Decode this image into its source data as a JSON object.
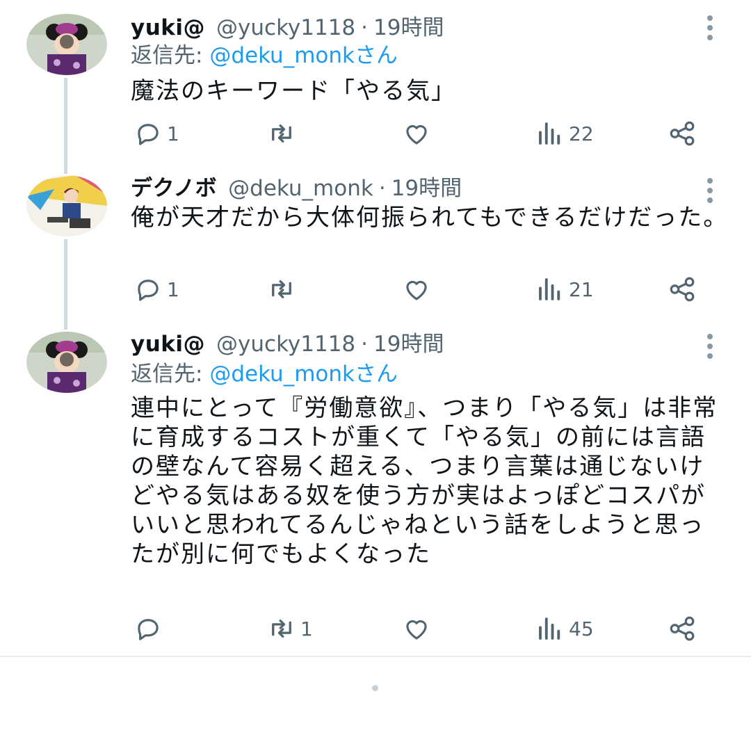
{
  "tweets": [
    {
      "name": "yuki@",
      "handle": "@yucky1118",
      "separator": "·",
      "time": "19時間",
      "reply_prefix": "返信先:",
      "reply_mention": "@deku_monkさん",
      "text": "魔法のキーワード「やる気」",
      "avatar_icon": "minnie-mouse-avatar",
      "replies": "1",
      "retweets": "",
      "likes": "",
      "views": "22"
    },
    {
      "name": "デクノボ",
      "handle": "@deku_monk",
      "separator": "·",
      "time": "19時間",
      "text": "俺が天才だから大体何振られてもできるだけだった。",
      "avatar_icon": "anime-character-avatar",
      "replies": "1",
      "retweets": "",
      "likes": "",
      "views": "21"
    },
    {
      "name": "yuki@",
      "handle": "@yucky1118",
      "separator": "·",
      "time": "19時間",
      "reply_prefix": "返信先:",
      "reply_mention": "@deku_monkさん",
      "text": "連中にとって『労働意欲』、つまり「やる気」は非常に育成するコストが重くて「やる気」の前には言語の壁なんて容易く超える、つまり言葉は通じないけどやる気はある奴を使う方が実はよっぽどコスパがいいと思われてるんじゃねという話をしようと思ったが別に何でもよくなった",
      "avatar_icon": "minnie-mouse-avatar",
      "replies": "",
      "retweets": "1",
      "likes": "",
      "views": "45"
    }
  ],
  "colors": {
    "text": "#0f1419",
    "secondary": "#536471",
    "link": "#1d9bf0",
    "thread_line": "#cfd9de"
  },
  "icons": [
    "reply-icon",
    "retweet-icon",
    "like-icon",
    "views-icon",
    "share-icon",
    "more-icon"
  ]
}
